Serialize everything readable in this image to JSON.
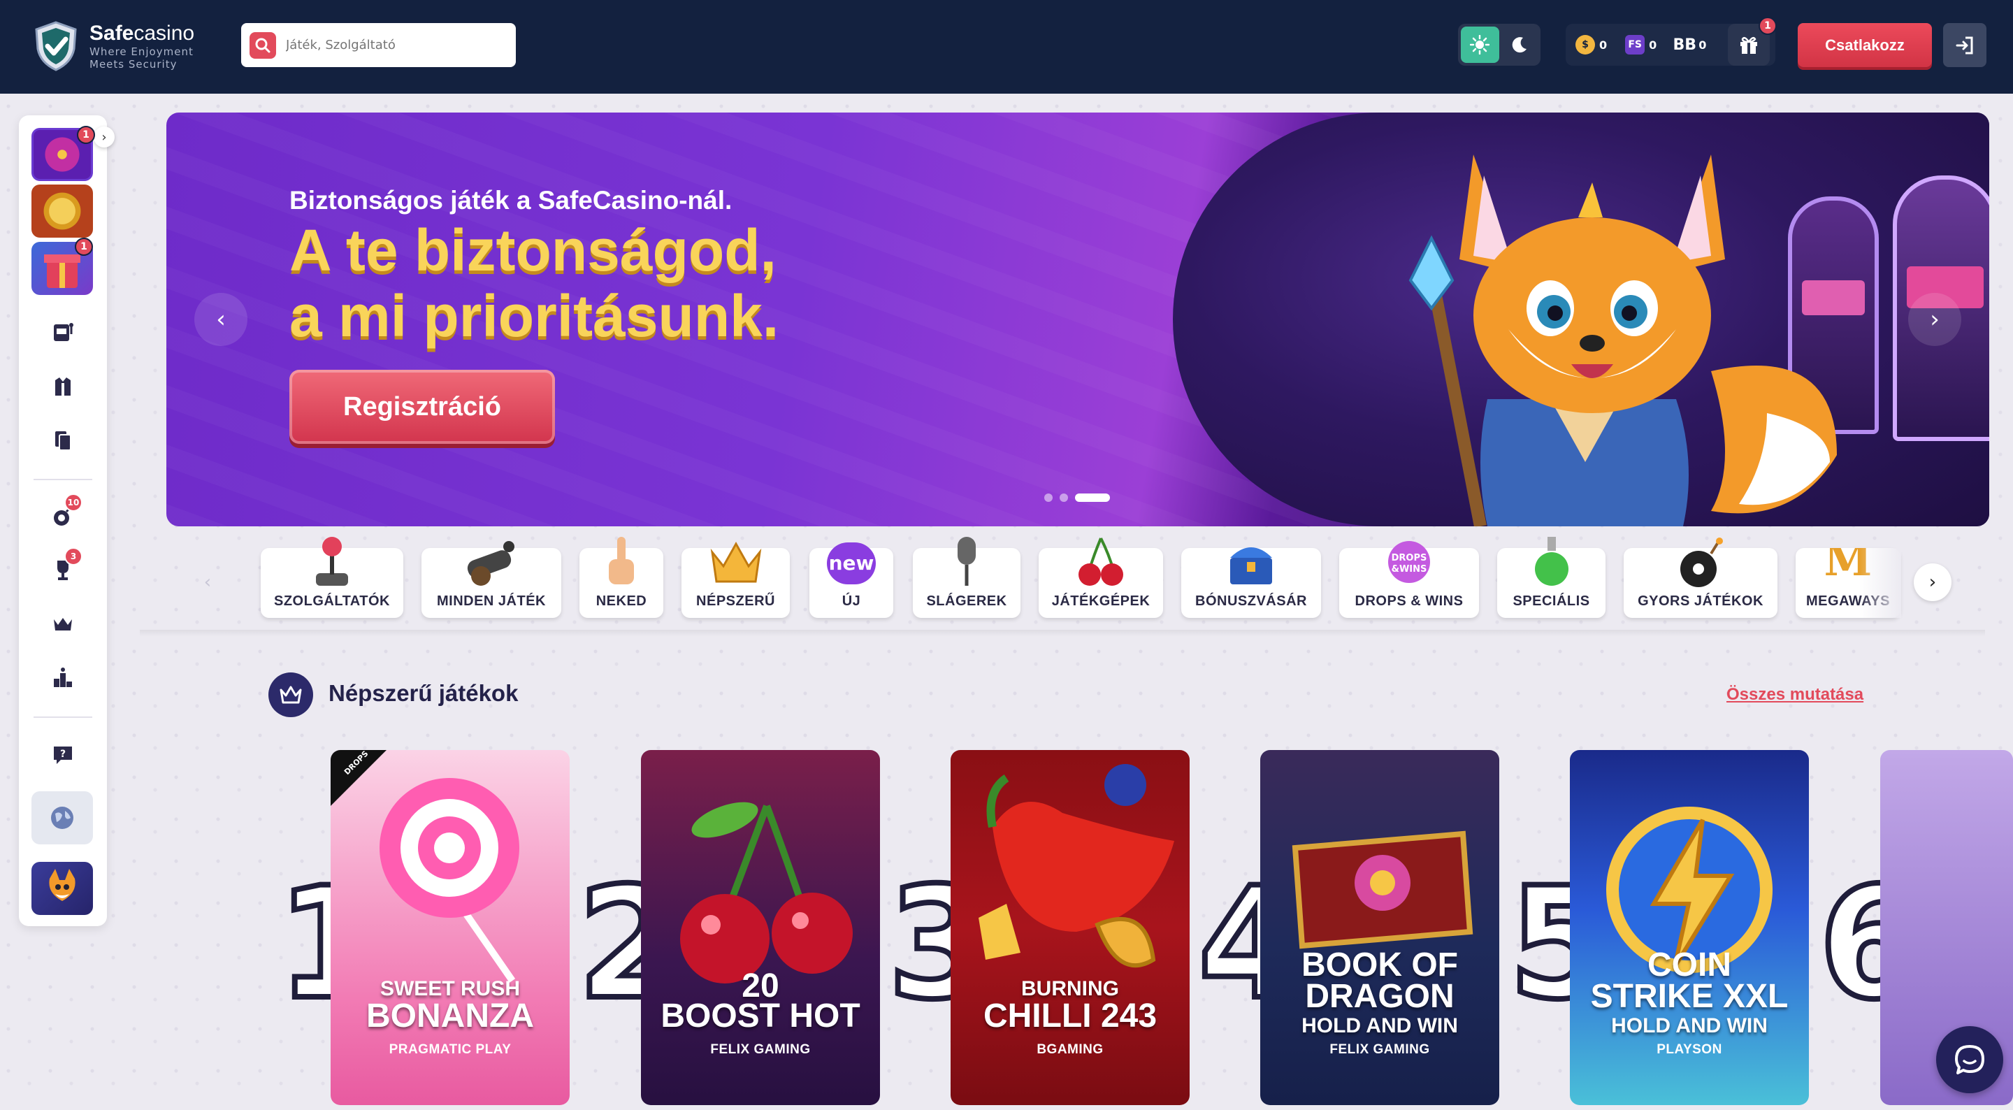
{
  "header": {
    "brand_bold": "Safe",
    "brand_light": "casino",
    "tagline_1": "Where Enjoyment",
    "tagline_2": "Meets Security",
    "search_placeholder": "Játék, Szolgáltató",
    "wallet": [
      {
        "code": "coin",
        "value": "0"
      },
      {
        "code": "FS",
        "value": "0"
      },
      {
        "code": "BB",
        "value": "0"
      }
    ],
    "gift_badge": "1",
    "join_label": "Csatlakozz"
  },
  "sidebar": {
    "tiles": [
      {
        "name": "wheel",
        "badge": "1"
      },
      {
        "name": "coin-bonus",
        "badge": ""
      },
      {
        "name": "gift-box",
        "badge": "1"
      }
    ],
    "icons": [
      {
        "name": "slot-machine-icon",
        "badge": ""
      },
      {
        "name": "live-casino-icon",
        "badge": ""
      },
      {
        "name": "cards-icon",
        "badge": ""
      },
      {
        "name": "bomb-icon",
        "badge": "10"
      },
      {
        "name": "trophy-icon",
        "badge": "3"
      },
      {
        "name": "crown-icon",
        "badge": ""
      },
      {
        "name": "leaderboard-icon",
        "badge": ""
      },
      {
        "name": "help-chat-icon",
        "badge": ""
      },
      {
        "name": "globe-icon",
        "badge": ""
      }
    ]
  },
  "banner": {
    "subtitle": "Biztonságos játék a SafeCasino-nál.",
    "title_line1": "A te biztonságod,",
    "title_line2": "a mi prioritásunk.",
    "cta_label": "Regisztráció",
    "slides": 3,
    "active_slide": 3
  },
  "categories": [
    {
      "label": "SZOLGÁLTATÓK",
      "icon": "joystick"
    },
    {
      "label": "MINDEN JÁTÉK",
      "icon": "cannon"
    },
    {
      "label": "NEKED",
      "icon": "pointing-hand"
    },
    {
      "label": "NÉPSZERŰ",
      "icon": "crown"
    },
    {
      "label": "ÚJ",
      "icon": "new-badge",
      "badge_text": "new"
    },
    {
      "label": "SLÁGEREK",
      "icon": "microphone"
    },
    {
      "label": "JÁTÉKGÉPEK",
      "icon": "cherries"
    },
    {
      "label": "BÓNUSZVÁSÁR",
      "icon": "treasure-chest"
    },
    {
      "label": "DROPS & WINS",
      "icon": "drops-wins"
    },
    {
      "label": "SPECIÁLIS",
      "icon": "potion"
    },
    {
      "label": "GYORS JÁTÉKOK",
      "icon": "bomb"
    },
    {
      "label": "MEGAWAYS",
      "icon": "megaways-m"
    }
  ],
  "popular": {
    "title": "Népszerű játékok",
    "show_all": "Összes mutatása",
    "games": [
      {
        "rank": "1",
        "line1": "SWEET RUSH",
        "line2": "BONANZA",
        "provider": "PRAGMATIC PLAY",
        "tag": "DROPS & WINS"
      },
      {
        "rank": "2",
        "line1": "20",
        "line2": "BOOST HOT",
        "provider": "FELIX GAMING",
        "tag": ""
      },
      {
        "rank": "3",
        "line1": "BURNING",
        "line2": "CHILLI 243",
        "provider": "BGAMING",
        "tag": ""
      },
      {
        "rank": "4",
        "line1": "BOOK OF",
        "line2": "DRAGON",
        "line3": "HOLD AND WIN",
        "provider": "FELIX GAMING",
        "tag": ""
      },
      {
        "rank": "5",
        "line1": "COIN",
        "line2": "STRIKE XXL",
        "line3": "HOLD AND WIN",
        "provider": "PLAYSON",
        "tag": ""
      },
      {
        "rank": "6",
        "line1": "",
        "line2": "",
        "provider": "",
        "tag": ""
      }
    ]
  },
  "colors": {
    "header_bg": "#13213f",
    "accent_red": "#e24a5b",
    "theme_green": "#3fbe9a",
    "banner_purple": "#7a34d4",
    "title_gold": "#f9d45a"
  }
}
